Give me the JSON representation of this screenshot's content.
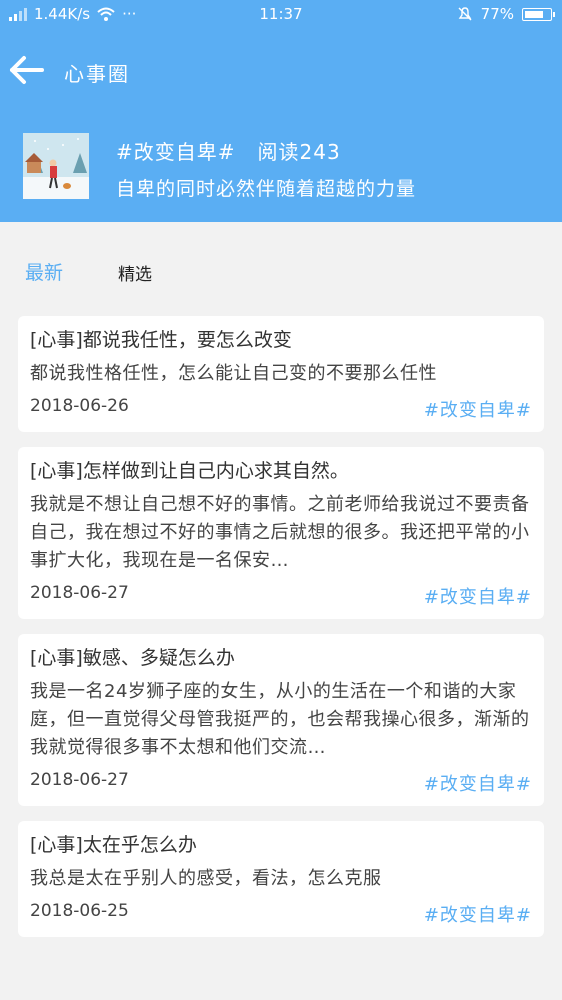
{
  "status_bar": {
    "speed": "1.44K/s",
    "more": "···",
    "time": "11:37",
    "battery_percent": "77%",
    "battery_level": 0.77
  },
  "header": {
    "back_icon": "arrow-left-icon",
    "title": "心事圈"
  },
  "topic": {
    "name": "#改变自卑#",
    "reads": "阅读243",
    "description": "自卑的同时必然伴随着超越的力量"
  },
  "tabs": [
    {
      "label": "最新",
      "active": true
    },
    {
      "label": "精选",
      "active": false
    }
  ],
  "posts": [
    {
      "title": "[心事]都说我任性，要怎么改变",
      "body": "都说我性格任性，怎么能让自己变的不要那么任性",
      "date": "2018-06-26",
      "tag": "#改变自卑#"
    },
    {
      "title": "[心事]怎样做到让自己内心求其自然。",
      "body": "我就是不想让自己想不好的事情。之前老师给我说过不要责备自己，我在想过不好的事情之后就想的很多。我还把平常的小事扩大化，我现在是一名保安…",
      "date": "2018-06-27",
      "tag": "#改变自卑#"
    },
    {
      "title": "[心事]敏感、多疑怎么办",
      "body": "我是一名24岁狮子座的女生，从小的生活在一个和谐的大家庭，但一直觉得父母管我挺严的，也会帮我操心很多，渐渐的我就觉得很多事不太想和他们交流…",
      "date": "2018-06-27",
      "tag": "#改变自卑#"
    },
    {
      "title": "[心事]太在乎怎么办",
      "body": "我总是太在乎别人的感受，看法，怎么克服",
      "date": "2018-06-25",
      "tag": "#改变自卑#"
    }
  ],
  "colors": {
    "primary": "#5aaef3",
    "background": "#f2f2f2",
    "card": "#ffffff"
  }
}
